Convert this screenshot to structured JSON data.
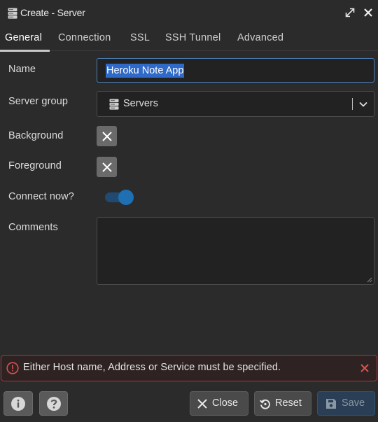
{
  "window": {
    "title": "Create - Server",
    "icon": "server-icon",
    "controls": [
      "expand-icon",
      "close-icon"
    ]
  },
  "tabs": [
    {
      "label": "General",
      "active": true
    },
    {
      "label": "Connection"
    },
    {
      "label": "SSL"
    },
    {
      "label": "SSH Tunnel"
    },
    {
      "label": "Advanced"
    }
  ],
  "form": {
    "name_label": "Name",
    "name_value": "Heroku Note App",
    "server_group_label": "Server group",
    "server_group_value": "Servers",
    "background_label": "Background",
    "foreground_label": "Foreground",
    "connect_now_label": "Connect now?",
    "connect_now_on": true,
    "comments_label": "Comments",
    "comments_value": ""
  },
  "error": {
    "message": "Either Host name, Address or Service must be specified."
  },
  "footer": {
    "close_label": "Close",
    "reset_label": "Reset",
    "save_label": "Save"
  },
  "colors": {
    "accent": "#1f6fb3",
    "error_border": "#a33a3a",
    "selection": "#2f6ac8"
  }
}
